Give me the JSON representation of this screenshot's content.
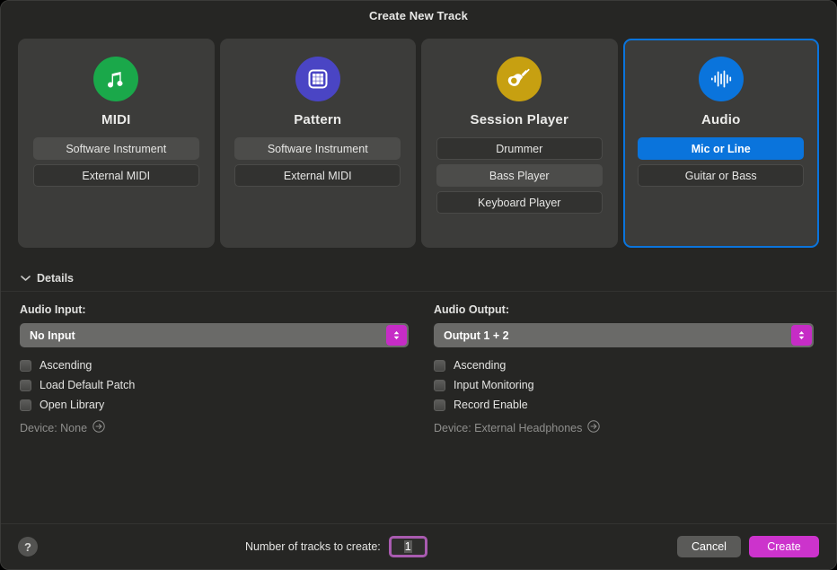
{
  "window": {
    "title": "Create New Track"
  },
  "cards": [
    {
      "id": "midi",
      "title": "MIDI",
      "icon": "music-note-icon",
      "icon_color": "#1aa84a",
      "selected": false,
      "options": [
        {
          "label": "Software Instrument",
          "state": "recent"
        },
        {
          "label": "External MIDI",
          "state": "normal"
        }
      ]
    },
    {
      "id": "pattern",
      "title": "Pattern",
      "icon": "grid-icon",
      "icon_color": "#4a45c4",
      "selected": false,
      "options": [
        {
          "label": "Software Instrument",
          "state": "recent"
        },
        {
          "label": "External MIDI",
          "state": "normal"
        }
      ]
    },
    {
      "id": "session-player",
      "title": "Session Player",
      "icon": "guitar-icon",
      "icon_color": "#c7a011",
      "selected": false,
      "options": [
        {
          "label": "Drummer",
          "state": "normal"
        },
        {
          "label": "Bass Player",
          "state": "recent"
        },
        {
          "label": "Keyboard Player",
          "state": "normal"
        }
      ]
    },
    {
      "id": "audio",
      "title": "Audio",
      "icon": "waveform-icon",
      "icon_color": "#0a74dc",
      "selected": true,
      "options": [
        {
          "label": "Mic or Line",
          "state": "active"
        },
        {
          "label": "Guitar or Bass",
          "state": "normal"
        }
      ]
    }
  ],
  "details": {
    "label": "Details",
    "disclosure_icon": "chevron-down-icon",
    "expanded": true,
    "left": {
      "field_label": "Audio Input:",
      "popup_value": "No Input",
      "stepper_icon": "up-down-chevron-icon",
      "checkboxes": [
        {
          "label": "Ascending",
          "checked": false
        },
        {
          "label": "Load Default Patch",
          "checked": false
        },
        {
          "label": "Open Library",
          "checked": false
        }
      ],
      "device_text": "Device: None",
      "device_icon": "arrow-right-circle-icon"
    },
    "right": {
      "field_label": "Audio Output:",
      "popup_value": "Output 1 + 2",
      "stepper_icon": "up-down-chevron-icon",
      "checkboxes": [
        {
          "label": "Ascending",
          "checked": false
        },
        {
          "label": "Input Monitoring",
          "checked": false
        },
        {
          "label": "Record Enable",
          "checked": false
        }
      ],
      "device_text": "Device: External Headphones",
      "device_icon": "arrow-right-circle-icon"
    }
  },
  "footer": {
    "help_label": "?",
    "help_icon": "question-mark-icon",
    "tracks_label": "Number of tracks to create:",
    "tracks_value": "1",
    "cancel_label": "Cancel",
    "create_label": "Create"
  },
  "colors": {
    "accent_blue": "#0a74dc",
    "accent_magenta": "#cc33cc",
    "stepper_magenta": "#c62cc6",
    "field_focus_border": "#a95bb0",
    "window_bg": "#262624",
    "card_bg": "#3c3c3a"
  }
}
